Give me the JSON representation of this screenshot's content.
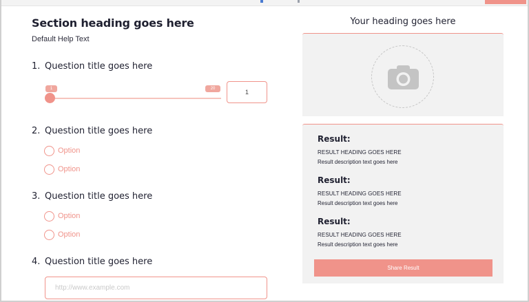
{
  "colors": {
    "accent": "#f0938a",
    "card_bg": "#f2f2f2",
    "text": "#1f2030"
  },
  "left": {
    "section_heading": "Section heading goes here",
    "help_text": "Default Help Text",
    "questions": [
      {
        "number": "1.",
        "title": "Question title goes here",
        "slider": {
          "min_label": "1",
          "max_label": "20",
          "value": "1",
          "min": 1,
          "max": 20,
          "current": 1
        }
      },
      {
        "number": "2.",
        "title": "Question title goes here",
        "options": [
          "Option",
          "Option"
        ]
      },
      {
        "number": "3.",
        "title": "Question title goes here",
        "options": [
          "Option",
          "Option"
        ]
      },
      {
        "number": "4.",
        "title": "Question title goes here",
        "url_placeholder": "http://www.example.com"
      }
    ]
  },
  "right": {
    "heading": "Your heading goes here",
    "image_icon": "camera-icon",
    "results": [
      {
        "title": "Result:",
        "heading": "RESULT HEADING GOES HERE",
        "description": "Result description text goes here"
      },
      {
        "title": "Result:",
        "heading": "RESULT HEADING GOES HERE",
        "description": "Result description text goes here"
      },
      {
        "title": "Result:",
        "heading": "RESULT HEADING GOES HERE",
        "description": "Result description text goes here"
      }
    ],
    "share_label": "Share Result"
  }
}
